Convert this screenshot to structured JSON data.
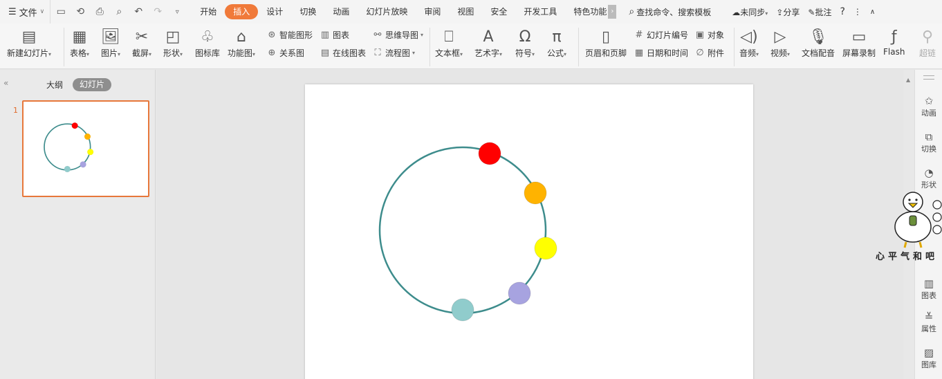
{
  "menubar": {
    "file_label": "文件",
    "tabs": [
      {
        "label": "开始"
      },
      {
        "label": "插入",
        "active": true
      },
      {
        "label": "设计"
      },
      {
        "label": "切换"
      },
      {
        "label": "动画"
      },
      {
        "label": "幻灯片放映"
      },
      {
        "label": "审阅"
      },
      {
        "label": "视图"
      },
      {
        "label": "安全"
      },
      {
        "label": "开发工具"
      },
      {
        "label": "特色功能"
      }
    ],
    "search_label": "查找命令、搜索模板",
    "sync_label": "未同步",
    "share_label": "分享",
    "comment_label": "批注",
    "active_color": "#f07a3a"
  },
  "ribbon": {
    "new_slide": "新建幻灯片",
    "table": "表格",
    "picture": "图片",
    "screenshot": "截屏",
    "shape": "形状",
    "icon_lib": "图标库",
    "function_chart": "功能图",
    "smart_shape": "智能图形",
    "chart": "图表",
    "mind_map": "思维导图",
    "relation": "关系图",
    "online_chart": "在线图表",
    "flowchart": "流程图",
    "textbox": "文本框",
    "wordart": "艺术字",
    "symbol": "符号",
    "formula": "公式",
    "header_footer": "页眉和页脚",
    "slide_number": "幻灯片编号",
    "object": "对象",
    "date_time": "日期和时间",
    "attachment": "附件",
    "audio": "音频",
    "video": "视频",
    "doc_voice": "文档配音",
    "screen_record": "屏幕录制",
    "flash": "Flash",
    "hyperlink": "超链"
  },
  "left_panel": {
    "outline_tab": "大纲",
    "slides_tab": "幻灯片",
    "slide_number": "1"
  },
  "right_panel": {
    "items": [
      "动画",
      "切换",
      "形状",
      "图表",
      "属性",
      "图库"
    ]
  },
  "watermark": {
    "text": "心平气和吧"
  },
  "slide": {
    "ring_color": "#3d8c8c",
    "dots": [
      {
        "color": "#ff0000"
      },
      {
        "color": "#ffb300"
      },
      {
        "color": "#ffff00"
      },
      {
        "color": "#a7a3e0"
      },
      {
        "color": "#90cccc"
      }
    ]
  }
}
